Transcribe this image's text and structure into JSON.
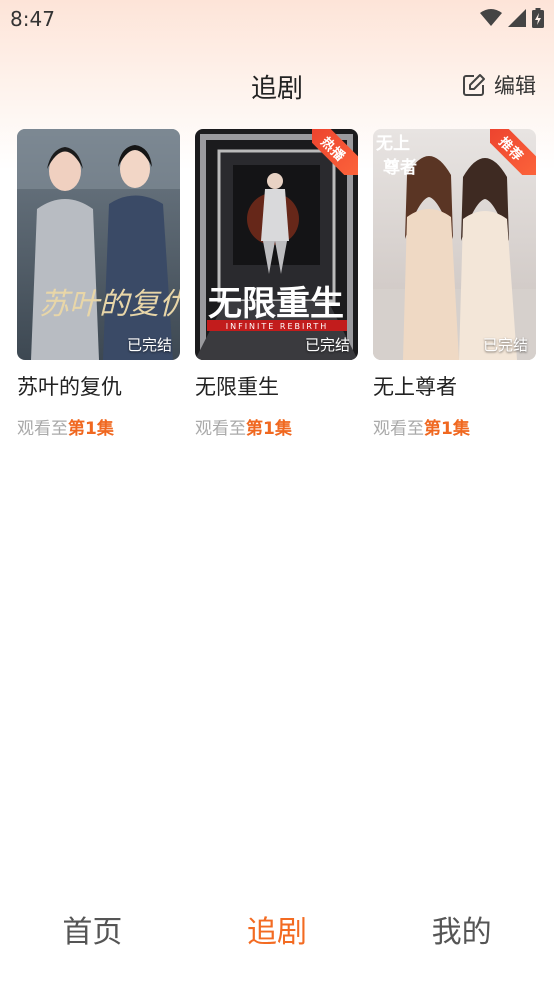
{
  "status_bar": {
    "time": "8:47",
    "icons": [
      "wifi-icon",
      "signal-icon",
      "battery-icon"
    ]
  },
  "header": {
    "title": "追剧",
    "edit_icon": "edit-icon",
    "edit_label": "编辑"
  },
  "shows": [
    {
      "title": "苏叶的复仇",
      "poster_text": "苏叶的复仇",
      "status": "已完结",
      "tag": "",
      "progress_prefix": "观看至",
      "progress_episode": "第1集"
    },
    {
      "title": "无限重生",
      "poster_text": "无限重生",
      "poster_subtext": "INFINITE REBIRTH",
      "status": "已完结",
      "tag": "热播",
      "progress_prefix": "观看至",
      "progress_episode": "第1集"
    },
    {
      "title": "无上尊者",
      "poster_text": "无上尊者",
      "status": "已完结",
      "tag": "推荐",
      "progress_prefix": "观看至",
      "progress_episode": "第1集"
    }
  ],
  "tabs": [
    {
      "label": "首页",
      "active": false
    },
    {
      "label": "追剧",
      "active": true
    },
    {
      "label": "我的",
      "active": false
    }
  ],
  "colors": {
    "accent": "#f36b22",
    "episode": "#f06820",
    "tag": "#e83a2b"
  }
}
